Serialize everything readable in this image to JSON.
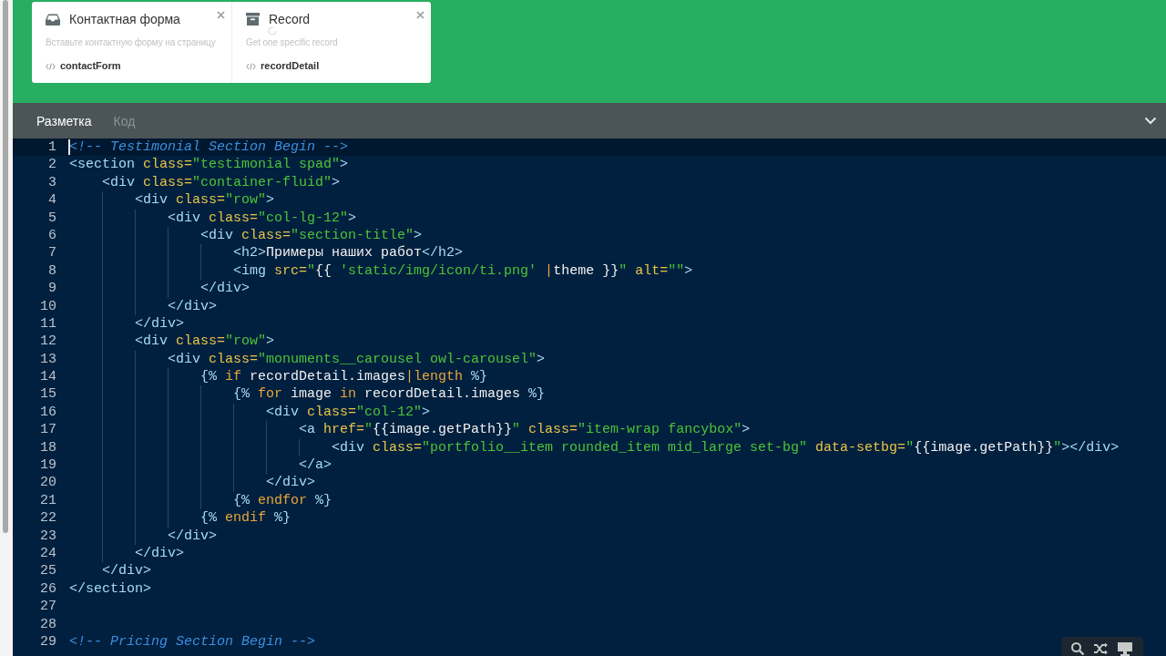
{
  "cards": [
    {
      "kind": "inbox",
      "title": "Контактная форма",
      "description": "Вставьте контактную форму на страницу",
      "code": "contactForm"
    },
    {
      "kind": "archive",
      "title": "Record",
      "description": "Get one specific record",
      "code": "recordDetail"
    }
  ],
  "tabs": [
    {
      "label": "Разметка",
      "selected": true
    },
    {
      "label": "Код",
      "selected": false
    }
  ],
  "lines": [
    {
      "number": "1",
      "current": true,
      "tokens": [
        {
          "kind": "comment",
          "t": "<!-- Testimonial Section Begin -->"
        }
      ]
    },
    {
      "number": "2",
      "current": false,
      "tokens": [
        {
          "kind": "tag",
          "t": "<section "
        },
        {
          "kind": "attr",
          "t": "class="
        },
        {
          "kind": "string",
          "t": "\"testimonial spad\""
        },
        {
          "kind": "tag",
          "t": ">"
        }
      ],
      "children": [
        {
          "number": "3",
          "current": false,
          "tokens": [
            {
              "kind": "tag",
              "t": "<div "
            },
            {
              "kind": "attr",
              "t": "class="
            },
            {
              "kind": "string",
              "t": "\"container-fluid\""
            },
            {
              "kind": "tag",
              "t": ">"
            }
          ],
          "children": [
            {
              "number": "4",
              "current": false,
              "tokens": [
                {
                  "kind": "tag",
                  "t": "<div "
                },
                {
                  "kind": "attr",
                  "t": "class="
                },
                {
                  "kind": "string",
                  "t": "\"row\""
                },
                {
                  "kind": "tag",
                  "t": ">"
                }
              ],
              "children": [
                {
                  "number": "5",
                  "current": false,
                  "tokens": [
                    {
                      "kind": "tag",
                      "t": "<div "
                    },
                    {
                      "kind": "attr",
                      "t": "class="
                    },
                    {
                      "kind": "string",
                      "t": "\"col-lg-12\""
                    },
                    {
                      "kind": "tag",
                      "t": ">"
                    }
                  ],
                  "children": [
                    {
                      "number": "6",
                      "current": false,
                      "tokens": [
                        {
                          "kind": "tag",
                          "t": "<div "
                        },
                        {
                          "kind": "attr",
                          "t": "class="
                        },
                        {
                          "kind": "string",
                          "t": "\"section-title\""
                        },
                        {
                          "kind": "tag",
                          "t": ">"
                        }
                      ],
                      "children": [
                        {
                          "number": "7",
                          "current": false,
                          "tokens": [
                            {
                              "kind": "tag",
                              "t": "<h2>"
                            },
                            {
                              "kind": "text",
                              "t": "Примеры наших работ"
                            },
                            {
                              "kind": "tag",
                              "t": "</h2>"
                            }
                          ]
                        },
                        {
                          "number": "8",
                          "current": false,
                          "tokens": [
                            {
                              "kind": "tag",
                              "t": "<img "
                            },
                            {
                              "kind": "attr",
                              "t": "src="
                            },
                            {
                              "kind": "string",
                              "t": "\""
                            },
                            {
                              "kind": "text",
                              "t": "{{ "
                            },
                            {
                              "kind": "string",
                              "t": "'static/img/icon/ti.png' "
                            },
                            {
                              "kind": "keyword",
                              "t": "|"
                            },
                            {
                              "kind": "text",
                              "t": "theme }}"
                            },
                            {
                              "kind": "string",
                              "t": "\" "
                            },
                            {
                              "kind": "attr",
                              "t": "alt="
                            },
                            {
                              "kind": "string",
                              "t": "\"\""
                            },
                            {
                              "kind": "tag",
                              "t": ">"
                            }
                          ]
                        }
                      ]
                    },
                    {
                      "number": "9",
                      "current": false,
                      "tokens": [
                        {
                          "kind": "tag",
                          "t": "</div>"
                        }
                      ]
                    }
                  ]
                },
                {
                  "number": "10",
                  "current": false,
                  "tokens": [
                    {
                      "kind": "tag",
                      "t": "</div>"
                    }
                  ]
                }
              ]
            },
            {
              "number": "11",
              "current": false,
              "tokens": [
                {
                  "kind": "tag",
                  "t": "</div>"
                }
              ]
            },
            {
              "number": "12",
              "current": false,
              "tokens": [
                {
                  "kind": "tag",
                  "t": "<div "
                },
                {
                  "kind": "attr",
                  "t": "class="
                },
                {
                  "kind": "string",
                  "t": "\"row\""
                },
                {
                  "kind": "tag",
                  "t": ">"
                }
              ],
              "children": [
                {
                  "number": "13",
                  "current": false,
                  "tokens": [
                    {
                      "kind": "tag",
                      "t": "<div "
                    },
                    {
                      "kind": "attr",
                      "t": "class="
                    },
                    {
                      "kind": "string",
                      "t": "\"monuments__carousel owl-carousel\""
                    },
                    {
                      "kind": "tag",
                      "t": ">"
                    }
                  ],
                  "children": [
                    {
                      "number": "14",
                      "current": false,
                      "tokens": [
                        {
                          "kind": "delim",
                          "t": "{% "
                        },
                        {
                          "kind": "keyword",
                          "t": "if "
                        },
                        {
                          "kind": "text",
                          "t": "recordDetail.images"
                        },
                        {
                          "kind": "keyword",
                          "t": "|length "
                        },
                        {
                          "kind": "delim",
                          "t": "%}"
                        }
                      ],
                      "children": [
                        {
                          "number": "15",
                          "current": false,
                          "tokens": [
                            {
                              "kind": "delim",
                              "t": "{% "
                            },
                            {
                              "kind": "keyword",
                              "t": "for "
                            },
                            {
                              "kind": "text",
                              "t": "image "
                            },
                            {
                              "kind": "keyword",
                              "t": "in "
                            },
                            {
                              "kind": "text",
                              "t": "recordDetail.images "
                            },
                            {
                              "kind": "delim",
                              "t": "%}"
                            }
                          ],
                          "children": [
                            {
                              "number": "16",
                              "current": false,
                              "tokens": [
                                {
                                  "kind": "tag",
                                  "t": "<div "
                                },
                                {
                                  "kind": "attr",
                                  "t": "class="
                                },
                                {
                                  "kind": "string",
                                  "t": "\"col-12\""
                                },
                                {
                                  "kind": "tag",
                                  "t": ">"
                                }
                              ],
                              "children": [
                                {
                                  "number": "17",
                                  "current": false,
                                  "tokens": [
                                    {
                                      "kind": "tag",
                                      "t": "<a "
                                    },
                                    {
                                      "kind": "attr",
                                      "t": "href="
                                    },
                                    {
                                      "kind": "string",
                                      "t": "\""
                                    },
                                    {
                                      "kind": "text",
                                      "t": "{{image.getPath}}"
                                    },
                                    {
                                      "kind": "string",
                                      "t": "\" "
                                    },
                                    {
                                      "kind": "attr",
                                      "t": "class="
                                    },
                                    {
                                      "kind": "string",
                                      "t": "\"item-wrap fancybox\""
                                    },
                                    {
                                      "kind": "tag",
                                      "t": ">"
                                    }
                                  ],
                                  "children": [
                                    {
                                      "number": "18",
                                      "current": false,
                                      "tokens": [
                                        {
                                          "kind": "tag",
                                          "t": "<div "
                                        },
                                        {
                                          "kind": "attr",
                                          "t": "class="
                                        },
                                        {
                                          "kind": "string",
                                          "t": "\"portfolio__item rounded_item mid_large set-bg\" "
                                        },
                                        {
                                          "kind": "attr",
                                          "t": "data-setbg="
                                        },
                                        {
                                          "kind": "string",
                                          "t": "\""
                                        },
                                        {
                                          "kind": "text",
                                          "t": "{{image.getPath}}"
                                        },
                                        {
                                          "kind": "string",
                                          "t": "\""
                                        },
                                        {
                                          "kind": "tag",
                                          "t": "></div>"
                                        }
                                      ]
                                    }
                                  ]
                                },
                                {
                                  "number": "19",
                                  "current": false,
                                  "tokens": [
                                    {
                                      "kind": "tag",
                                      "t": "</a>"
                                    }
                                  ]
                                }
                              ]
                            },
                            {
                              "number": "20",
                              "current": false,
                              "tokens": [
                                {
                                  "kind": "tag",
                                  "t": "</div>"
                                }
                              ]
                            }
                          ]
                        },
                        {
                          "number": "21",
                          "current": false,
                          "tokens": [
                            {
                              "kind": "delim",
                              "t": "{% "
                            },
                            {
                              "kind": "keyword",
                              "t": "endfor "
                            },
                            {
                              "kind": "delim",
                              "t": "%}"
                            }
                          ]
                        }
                      ]
                    },
                    {
                      "number": "22",
                      "current": false,
                      "tokens": [
                        {
                          "kind": "delim",
                          "t": "{% "
                        },
                        {
                          "kind": "keyword",
                          "t": "endif "
                        },
                        {
                          "kind": "delim",
                          "t": "%}"
                        }
                      ]
                    }
                  ]
                },
                {
                  "number": "23",
                  "current": false,
                  "tokens": [
                    {
                      "kind": "tag",
                      "t": "</div>"
                    }
                  ]
                }
              ]
            },
            {
              "number": "24",
              "current": false,
              "tokens": [
                {
                  "kind": "tag",
                  "t": "</div>"
                }
              ]
            }
          ]
        },
        {
          "number": "25",
          "current": false,
          "tokens": [
            {
              "kind": "tag",
              "t": "</div>"
            }
          ]
        }
      ]
    },
    {
      "number": "26",
      "current": false,
      "tokens": [
        {
          "kind": "tag",
          "t": "</section>"
        }
      ]
    },
    {
      "number": "27",
      "current": false
    },
    {
      "number": "28",
      "current": false
    },
    {
      "number": "29",
      "current": false,
      "tokens": [
        {
          "kind": "comment",
          "t": "<!-- Pricing Section Begin -->"
        }
      ]
    }
  ]
}
